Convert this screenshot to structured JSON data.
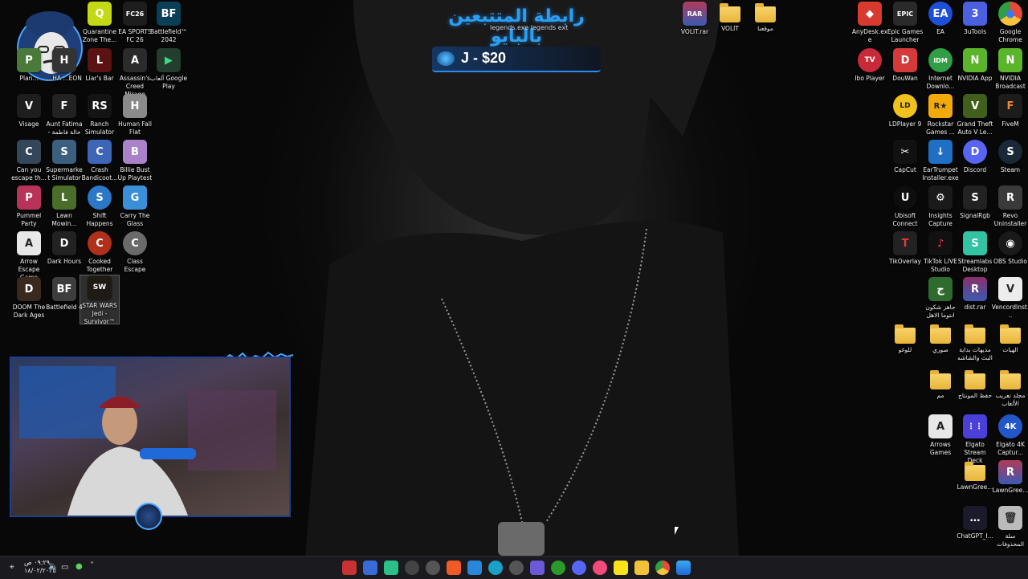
{
  "desktop": {
    "left_icons": [
      {
        "label": "Quarantine Zone The...",
        "color": "#c4d916",
        "glyph": "Q"
      },
      {
        "label": "EA SPORTS FC 26",
        "color": "#1d1d1d",
        "glyph": "FC26"
      },
      {
        "label": "Battlefield™ 2042",
        "color": "#0b3e57",
        "glyph": "BF"
      },
      {
        "label": "Plan...",
        "color": "#4a7a39",
        "glyph": "P"
      },
      {
        "label": "...HA ...EON",
        "color": "#333",
        "glyph": "H"
      },
      {
        "label": "Liar's Bar",
        "color": "#5a1212",
        "glyph": "L"
      },
      {
        "label": "Assassin's Creed Mirage",
        "color": "#2b2b2b",
        "glyph": "A"
      },
      {
        "label": "ألعاب Google Play",
        "color": "#233d2e",
        "glyph": "▶"
      },
      {
        "label": "Visage",
        "color": "#1e1e1e",
        "glyph": "V"
      },
      {
        "label": "Aunt Fatima - خالة فاطمة",
        "color": "#222",
        "glyph": "F"
      },
      {
        "label": "Ranch Simulator",
        "color": "#141414",
        "glyph": "RS"
      },
      {
        "label": "Human Fall Flat",
        "color": "#8a8a8a",
        "glyph": "H"
      },
      {
        "label": "Can you escape th...",
        "color": "#34475a",
        "glyph": "C"
      },
      {
        "label": "Supermarket Simulator",
        "color": "#3b5f7e",
        "glyph": "S"
      },
      {
        "label": "Crash Bandicoot...",
        "color": "#3d65b8",
        "glyph": "C"
      },
      {
        "label": "Billie Bust Up Playtest",
        "color": "#a982c9",
        "glyph": "B"
      },
      {
        "label": "Pummel Party",
        "color": "#b8335a",
        "glyph": "P"
      },
      {
        "label": "Lawn Mowin...",
        "color": "#4b6d2a",
        "glyph": "L"
      },
      {
        "label": "Shift Happens",
        "color": "#2b78c7",
        "glyph": "S"
      },
      {
        "label": "Carry The Glass",
        "color": "#3b8fd8",
        "glyph": "G"
      },
      {
        "label": "Arrow Escape Game",
        "color": "#e8e8e8",
        "glyph": "A"
      },
      {
        "label": "Dark Hours",
        "color": "#222",
        "glyph": "D"
      },
      {
        "label": "Cooked Together",
        "color": "#b0301c",
        "glyph": "C"
      },
      {
        "label": "Class Escape",
        "color": "#6a6a6a",
        "glyph": "C"
      },
      {
        "label": "DOOM The Dark Ages",
        "color": "#3a2a1e",
        "glyph": "D"
      },
      {
        "label": "Battlefield 4",
        "color": "#3d3d3d",
        "glyph": "BF"
      },
      {
        "label": "STAR WARS Jedi - Survivor™",
        "color": "#1e1a14",
        "glyph": "SW"
      }
    ],
    "top_center_icons": [
      {
        "label": "VOLIT.rar",
        "kind": "archive"
      },
      {
        "label": "VOLIT",
        "kind": "folder"
      },
      {
        "label": "موقعنا",
        "kind": "folder"
      }
    ],
    "right_icons": [
      {
        "label": "AnyDesk.exe",
        "color": "#d83a2f",
        "glyph": "◆"
      },
      {
        "label": "Epic Games Launcher",
        "color": "#2a2a2a",
        "glyph": "EPIC"
      },
      {
        "label": "EA",
        "color": "#1d4fd8",
        "glyph": "EA"
      },
      {
        "label": "3uTools",
        "color": "#4a60e0",
        "glyph": "3"
      },
      {
        "label": "Google Chrome",
        "color": "#2a2a2a",
        "glyph": "●"
      },
      {
        "label": "Ibo Player",
        "color": "#c92a3a",
        "glyph": "TV"
      },
      {
        "label": "DouWan",
        "color": "#d43a3a",
        "glyph": "D"
      },
      {
        "label": "Internet Downlo...",
        "color": "#2f9e44",
        "glyph": "IDM"
      },
      {
        "label": "NVIDIA App",
        "color": "#5bb52a",
        "glyph": "N"
      },
      {
        "label": "NVIDIA Broadcast",
        "color": "#5bb52a",
        "glyph": "N"
      },
      {
        "label": "LDPlayer 9",
        "color": "#f1c21b",
        "glyph": "LD"
      },
      {
        "label": "Rockstar Games ...",
        "color": "#f2a90a",
        "glyph": "R★"
      },
      {
        "label": "Grand Theft Auto V Le...",
        "color": "#3f5f1a",
        "glyph": "V"
      },
      {
        "label": "FiveM",
        "color": "#1c1c1c",
        "glyph": "F"
      },
      {
        "label": "CapCut",
        "color": "#111",
        "glyph": "✂"
      },
      {
        "label": "EarTrumpet Installer.exe",
        "color": "#1f6fc4",
        "glyph": "↓"
      },
      {
        "label": "Discord",
        "color": "#5865f2",
        "glyph": "D"
      },
      {
        "label": "Steam",
        "color": "#1b2838",
        "glyph": "S"
      },
      {
        "label": "Ubisoft Connect",
        "color": "#0e0e0e",
        "glyph": "U"
      },
      {
        "label": "Insights Capture",
        "color": "#1a1a1a",
        "glyph": "⚙"
      },
      {
        "label": "SignalRgb",
        "color": "#222",
        "glyph": "S"
      },
      {
        "label": "Revo Uninstaller",
        "color": "#3a3a3a",
        "glyph": "R"
      },
      {
        "label": "TikOverlay",
        "color": "#222",
        "glyph": "T"
      },
      {
        "label": "TikTok LIVE Studio",
        "color": "#111",
        "glyph": "♪"
      },
      {
        "label": "Streamlabs Desktop",
        "color": "#31c3a2",
        "glyph": "S"
      },
      {
        "label": "OBS Studio",
        "color": "#1a1a1a",
        "glyph": "◉"
      },
      {
        "label": "جاهز شكون انتوما الاهل",
        "color": "#2f6a2f",
        "glyph": "ج"
      },
      {
        "label": "dist.rar",
        "color": "#8a2f6a",
        "glyph": "R"
      },
      {
        "label": "VencordInst...",
        "color": "#ececec",
        "glyph": "V"
      },
      {
        "label": "للوغو",
        "color": "#e8b53a",
        "glyph": ""
      },
      {
        "label": "صوري",
        "color": "#e8b53a",
        "glyph": ""
      },
      {
        "label": "مديهات بداية البث والشاشه",
        "color": "#e8b53a",
        "glyph": ""
      },
      {
        "label": "الهبات",
        "color": "#e8b53a",
        "glyph": ""
      },
      {
        "label": "مم",
        "color": "#e8b53a",
        "glyph": ""
      },
      {
        "label": "حفظ المونتاج",
        "color": "#e8b53a",
        "glyph": ""
      },
      {
        "label": "مجلد تعريب الألعاب",
        "color": "#e8b53a",
        "glyph": ""
      },
      {
        "label": "Arrows Games",
        "color": "#e8e8e8",
        "glyph": "A"
      },
      {
        "label": "Elgato Stream Deck",
        "color": "#4a3fd8",
        "glyph": "⋮⋮"
      },
      {
        "label": "Elgato 4K Captur...",
        "color": "#2256c9",
        "glyph": "4K"
      },
      {
        "label": "LawnGree...",
        "color": "#e8b53a",
        "glyph": ""
      },
      {
        "label": "LawnGree...",
        "color": "#b23a5a",
        "glyph": "R"
      },
      {
        "label": "ChatGPT_I...",
        "color": "#1a1a2a",
        "glyph": "…"
      },
      {
        "label": "سلة المحذوفات",
        "color": "#bbbbbb",
        "glyph": "🗑"
      }
    ]
  },
  "overlay": {
    "title": "رابطة المتتبعين بالبايو",
    "subtitle": "legends.exe legends ext",
    "goal_text": "J - $20",
    "accent": "#2c9ff0"
  },
  "taskbar": {
    "clock_time": "٠٩:٢٩ ص",
    "clock_date": "١٨/٠٢/٢٠٢٥",
    "apps": [
      {
        "name": "video-editor-icon",
        "color": "#c83232"
      },
      {
        "name": "people-icon",
        "color": "#3a6ad8"
      },
      {
        "name": "green-app-icon",
        "color": "#2bbf8a"
      },
      {
        "name": "chatgpt-icon",
        "color": "#e8e8e8"
      },
      {
        "name": "openai-icon",
        "color": "#dddddd"
      },
      {
        "name": "brave-icon",
        "color": "#f05a24"
      },
      {
        "name": "mail-icon",
        "color": "#2a86d8"
      },
      {
        "name": "edge-icon",
        "color": "#1aa1c8"
      },
      {
        "name": "chatgpt-icon-2",
        "color": "#e8e8e8"
      },
      {
        "name": "obs-icon",
        "color": "#6a5ad8"
      },
      {
        "name": "xbox-icon",
        "color": "#2a9a2a"
      },
      {
        "name": "discord-icon",
        "color": "#5865f2"
      },
      {
        "name": "itunes-icon",
        "color": "#f24a7a"
      },
      {
        "name": "snapchat-icon",
        "color": "#f8e21a"
      },
      {
        "name": "file-explorer-icon",
        "color": "#f2c13a"
      },
      {
        "name": "chrome-icon",
        "color": "#e84a3a"
      },
      {
        "name": "start-icon",
        "color": "#3aa8f0"
      }
    ]
  }
}
